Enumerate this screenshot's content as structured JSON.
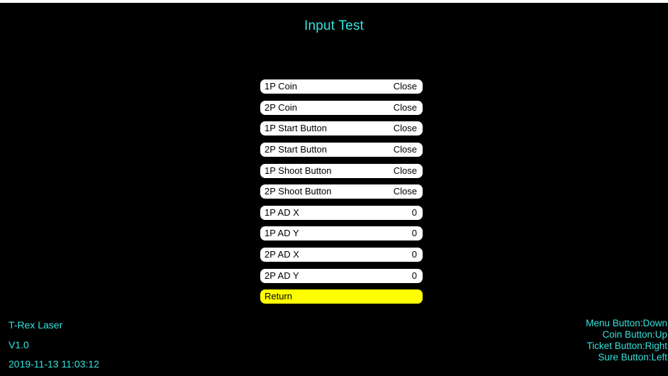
{
  "title": "Input Test",
  "menu": {
    "items": [
      {
        "label": "1P Coin",
        "value": "Close"
      },
      {
        "label": "2P Coin",
        "value": "Close"
      },
      {
        "label": "1P Start Button",
        "value": "Close"
      },
      {
        "label": "2P Start Button",
        "value": "Close"
      },
      {
        "label": "1P Shoot Button",
        "value": "Close"
      },
      {
        "label": "2P Shoot Button",
        "value": "Close"
      },
      {
        "label": "1P AD X",
        "value": "0"
      },
      {
        "label": "1P AD Y",
        "value": "0"
      },
      {
        "label": "2P AD X",
        "value": "0"
      },
      {
        "label": "2P AD Y",
        "value": "0"
      }
    ],
    "return_label": "Return"
  },
  "info": {
    "game_name": "T-Rex Laser",
    "version": "V1.0",
    "datetime": "2019-11-13 11:03:12"
  },
  "controls": {
    "menu": "Menu Button:Down",
    "coin": "Coin Button:Up",
    "ticket": "Ticket Button:Right",
    "sure": "Sure Button:Left"
  },
  "colors": {
    "background": "#000000",
    "text_accent": "#35e2de",
    "row_bg": "#ffffff",
    "selected_bg": "#ffff00"
  }
}
